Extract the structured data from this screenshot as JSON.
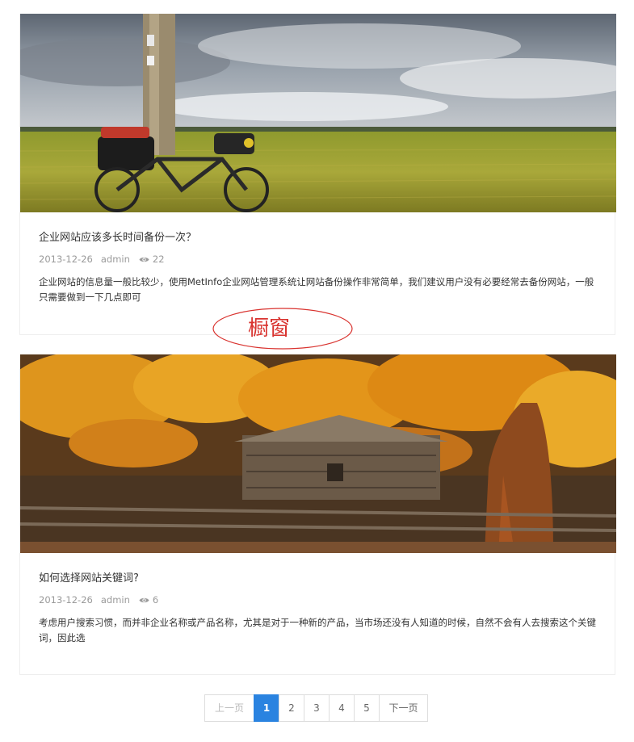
{
  "articles": [
    {
      "title": "企业网站应该多长时间备份一次？",
      "date": "2013-12-26",
      "author": "admin",
      "views": "22",
      "description": "企业网站的信息量一般比较少，使用MetInfo企业网站管理系统让网站备份操作非常简单，我们建议用户没有必要经常去备份网站，一般只需要做到一下几点即可"
    },
    {
      "title": "如何选择网站关键词?",
      "date": "2013-12-26",
      "author": "admin",
      "views": "6",
      "description": "考虑用户搜索习惯，而并非企业名称或产品名称，尤其是对于一种新的产品，当市场还没有人知道的时候，自然不会有人去搜索这个关键词，因此选"
    }
  ],
  "annotation": {
    "text": "橱窗",
    "color": "#d9332f"
  },
  "pagination": {
    "prev": "上一页",
    "pages": [
      "1",
      "2",
      "3",
      "4",
      "5"
    ],
    "active_page": "1",
    "next": "下一页",
    "accent": "#2a83e0"
  },
  "icons": {
    "views": "eye-icon"
  }
}
